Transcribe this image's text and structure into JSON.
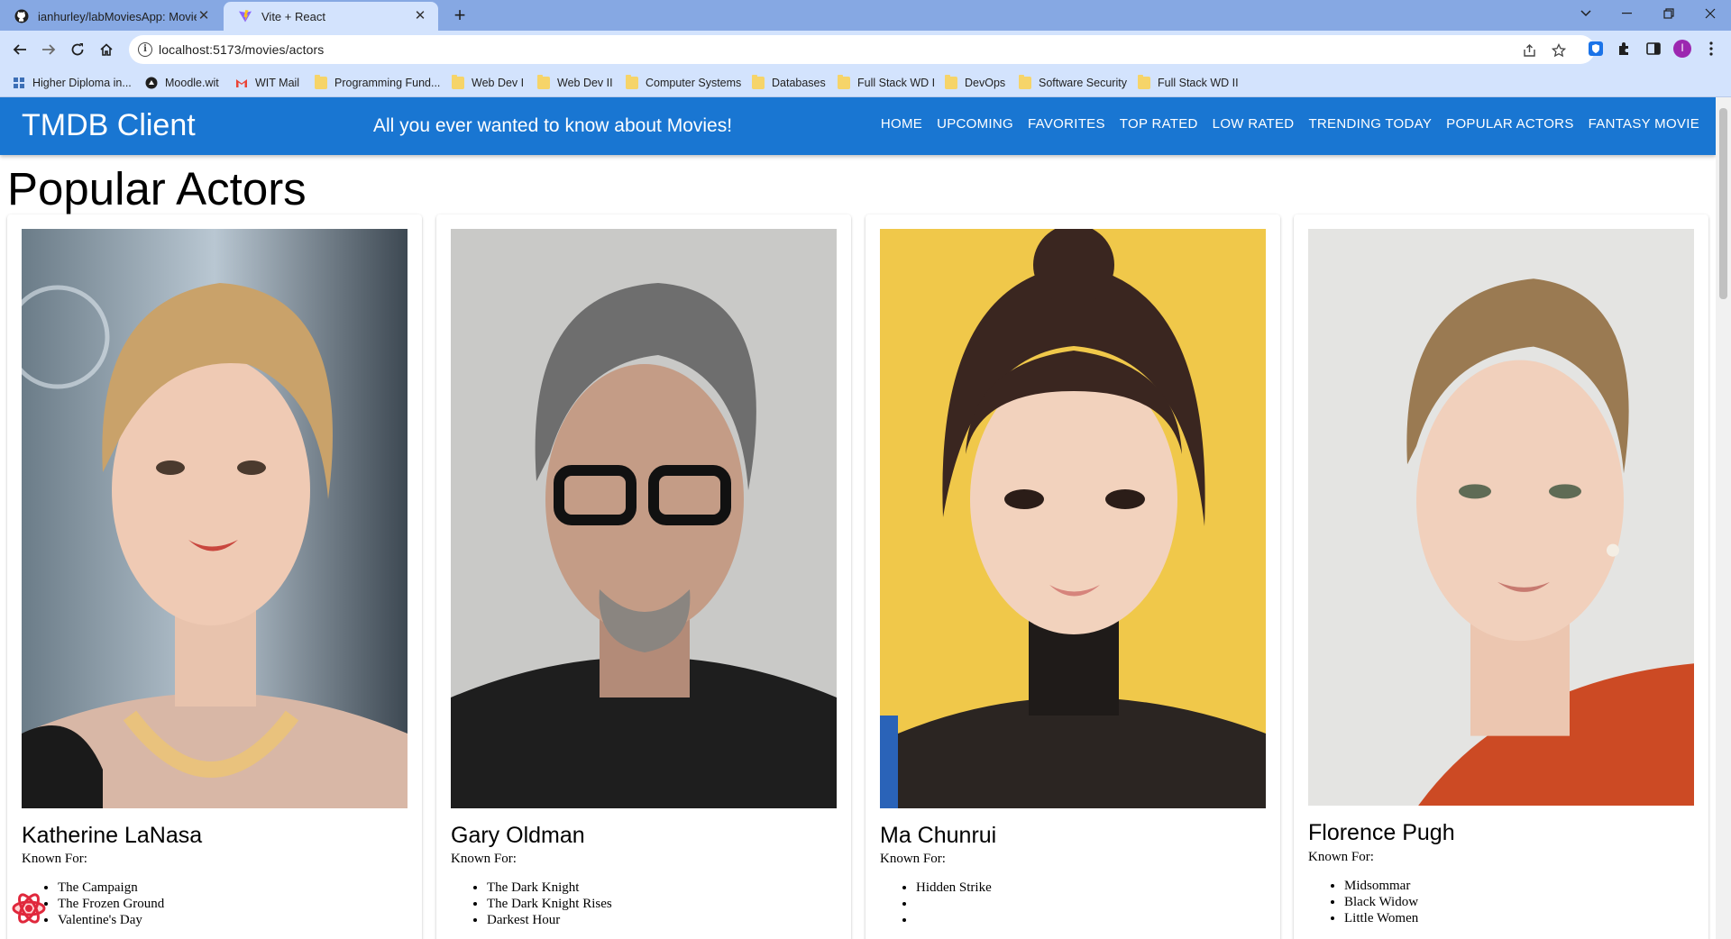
{
  "browser": {
    "tabs": [
      {
        "title": "ianhurley/labMoviesApp: Movie",
        "active": false
      },
      {
        "title": "Vite + React",
        "active": true
      }
    ],
    "url": "localhost:5173/movies/actors",
    "bookmarks": [
      {
        "label": "Higher Diploma in...",
        "icon": "grid-icon"
      },
      {
        "label": "Moodle.wit",
        "icon": "moodle-icon"
      },
      {
        "label": "WIT Mail",
        "icon": "gmail-icon"
      },
      {
        "label": "Programming Fund...",
        "icon": "folder-icon"
      },
      {
        "label": "Web Dev I",
        "icon": "folder-icon"
      },
      {
        "label": "Web Dev II",
        "icon": "folder-icon"
      },
      {
        "label": "Computer Systems",
        "icon": "folder-icon"
      },
      {
        "label": "Databases",
        "icon": "folder-icon"
      },
      {
        "label": "Full Stack WD I",
        "icon": "folder-icon"
      },
      {
        "label": "DevOps",
        "icon": "folder-icon"
      },
      {
        "label": "Software Security",
        "icon": "folder-icon"
      },
      {
        "label": "Full Stack WD II",
        "icon": "folder-icon"
      }
    ],
    "profile_initial": "I"
  },
  "app": {
    "brand": "TMDB Client",
    "tagline": "All you ever wanted to know about Movies!",
    "nav": [
      "Home",
      "Upcoming",
      "Favorites",
      "Top Rated",
      "Low Rated",
      "Trending Today",
      "Popular Actors",
      "Fantasy Movie"
    ]
  },
  "page": {
    "title": "Popular Actors",
    "known_for_label": "Known For:",
    "actors": [
      {
        "name": "Katherine LaNasa",
        "films": [
          "The Campaign",
          "The Frozen Ground",
          "Valentine's Day"
        ]
      },
      {
        "name": "Gary Oldman",
        "films": [
          "The Dark Knight",
          "The Dark Knight Rises",
          "Darkest Hour"
        ]
      },
      {
        "name": "Ma Chunrui",
        "films": [
          "Hidden Strike",
          "",
          ""
        ]
      },
      {
        "name": "Florence Pugh",
        "films": [
          "Midsommar",
          "Black Widow",
          "Little Women"
        ]
      }
    ]
  },
  "colors": {
    "appbar": "#1976d2",
    "tabstrip": "#86a8e3",
    "toolbar": "#d3e3fd"
  }
}
